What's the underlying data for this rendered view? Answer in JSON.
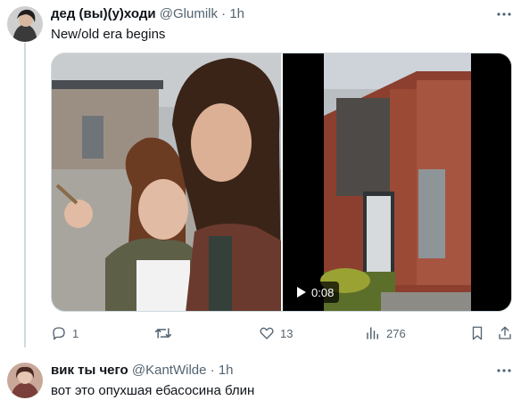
{
  "tweet": {
    "author_name": "дед (вы)(у)ходи",
    "handle": "@Glumilk",
    "separator": "·",
    "time": "1h",
    "text": "New/old era begins",
    "media": {
      "video_duration": "0:08",
      "left_photo_icon": "photo",
      "right_video_icon": "video-thumbnail"
    },
    "actions": {
      "replies": "1",
      "retweets": "",
      "likes": "13",
      "views": "276"
    }
  },
  "reply": {
    "author_name": "вик ты чего",
    "handle": "@KantWilde",
    "separator": "·",
    "time": "1h",
    "text": "вот это опухшая ебасосина блин"
  },
  "colors": {
    "text": "#0f1419",
    "secondary": "#536471",
    "border": "#cfd9de"
  }
}
